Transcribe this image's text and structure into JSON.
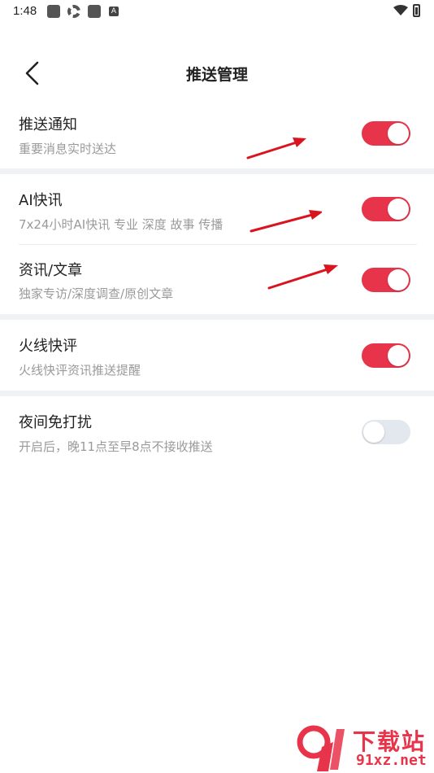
{
  "status_bar": {
    "time": "1:48",
    "indicator_letter": "A"
  },
  "header": {
    "title": "推送管理"
  },
  "settings": [
    {
      "title": "推送通知",
      "subtitle": "重要消息实时送达",
      "enabled": true
    },
    {
      "title": "AI快讯",
      "subtitle": "7x24小时AI快讯 专业 深度 故事 传播",
      "enabled": true
    },
    {
      "title": "资讯/文章",
      "subtitle": "独家专访/深度调查/原创文章",
      "enabled": true
    },
    {
      "title": "火线快评",
      "subtitle": "火线快评资讯推送提醒",
      "enabled": true
    },
    {
      "title": "夜间免打扰",
      "subtitle": "开启后，晚11点至早8点不接收推送",
      "enabled": false
    }
  ],
  "watermark": {
    "title": "下载站",
    "url": "91xz.net"
  },
  "colors": {
    "toggle_on": "#e8344a",
    "toggle_off": "#e3e7ee",
    "arrow": "#d9141e",
    "band": "#f0f2f5"
  }
}
